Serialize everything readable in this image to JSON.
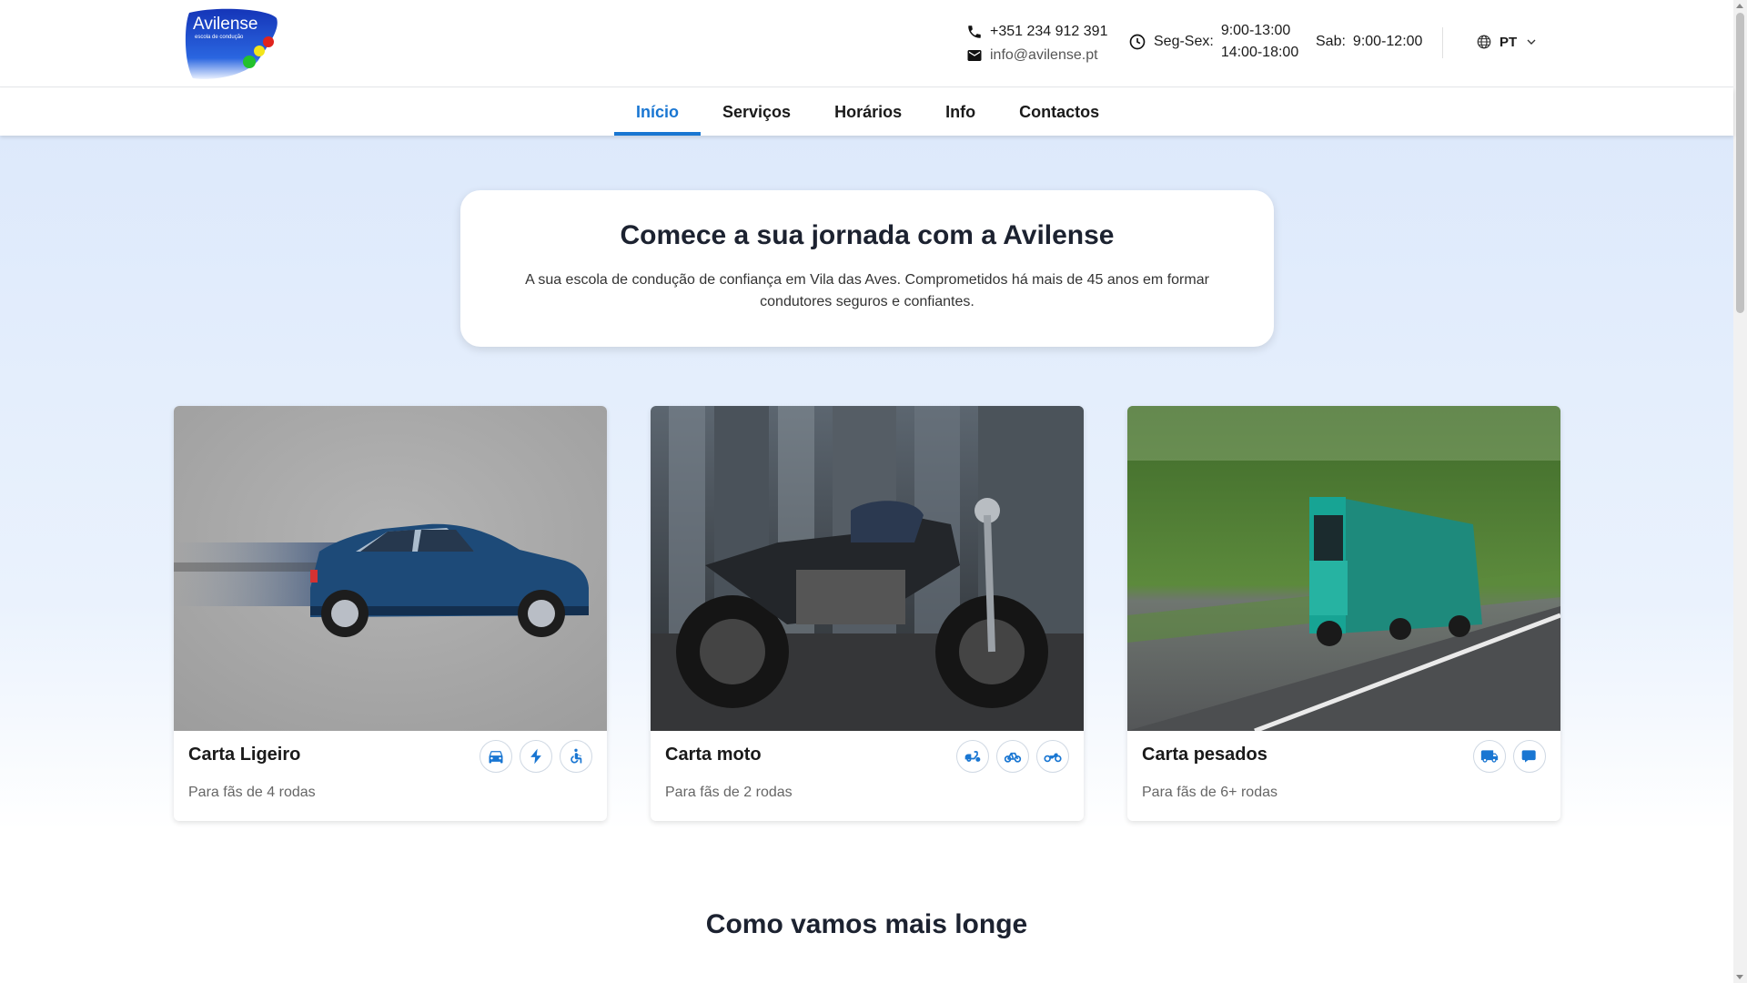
{
  "brand": {
    "logo_text": "Avilense",
    "logo_subtext": "escola de condução"
  },
  "header": {
    "phone": "+351 234 912 391",
    "email": "info@avilense.pt",
    "weekday_label": "Seg-Sex:",
    "weekday_morning": "9:00-13:00",
    "weekday_afternoon": "14:00-18:00",
    "saturday_label": "Sab:",
    "saturday_hours": "9:00-12:00",
    "language": "PT"
  },
  "nav": {
    "items": [
      {
        "label": "Início",
        "active": true
      },
      {
        "label": "Serviços"
      },
      {
        "label": "Horários"
      },
      {
        "label": "Info"
      },
      {
        "label": "Contactos"
      }
    ]
  },
  "hero": {
    "title": "Comece a sua jornada com a Avilense",
    "text": "A sua escola de condução de confiança em Vila das Aves. Comprometidos há mais de 45 anos em formar condutores seguros e confiantes."
  },
  "cards": [
    {
      "title": "Carta Ligeiro",
      "subtitle": "Para fãs de 4 rodas",
      "icons": [
        "car-icon",
        "electric-bolt-icon",
        "accessible-icon"
      ]
    },
    {
      "title": "Carta moto",
      "subtitle": "Para fãs de 2 rodas",
      "icons": [
        "moped-icon",
        "bicycle-icon",
        "motorcycle-icon"
      ]
    },
    {
      "title": "Carta pesados",
      "subtitle": "Para fãs de 6+ rodas",
      "icons": [
        "truck-icon",
        "bus-icon"
      ]
    }
  ],
  "section": {
    "title": "Como vamos mais longe"
  },
  "colors": {
    "accent": "#1976d2",
    "heading": "#1c2230",
    "background_top": "#dde9fb"
  }
}
